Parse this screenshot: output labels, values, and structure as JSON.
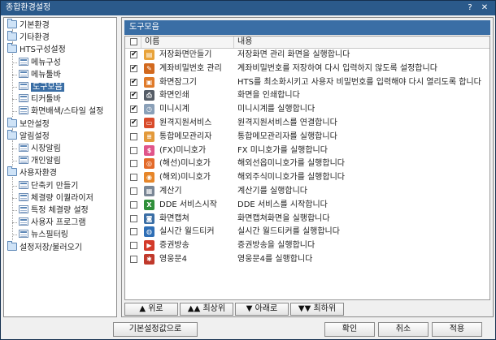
{
  "window": {
    "title": "종합환경설정",
    "help": "?",
    "close": "✕"
  },
  "tree": [
    {
      "label": "기본환경",
      "type": "folder",
      "level": 0
    },
    {
      "label": "기타환경",
      "type": "folder",
      "level": 0
    },
    {
      "label": "HTS구성설정",
      "type": "folder",
      "level": 0
    },
    {
      "label": "메뉴구성",
      "type": "page",
      "level": 1
    },
    {
      "label": "메뉴툴바",
      "type": "page",
      "level": 1
    },
    {
      "label": "도구모음",
      "type": "page",
      "level": 1,
      "selected": true
    },
    {
      "label": "티커툴바",
      "type": "page",
      "level": 1
    },
    {
      "label": "화면배색/스타일 설정",
      "type": "page",
      "level": 1
    },
    {
      "label": "보안설정",
      "type": "folder",
      "level": 0
    },
    {
      "label": "알림설정",
      "type": "folder",
      "level": 0
    },
    {
      "label": "시장알림",
      "type": "page",
      "level": 1
    },
    {
      "label": "개인알림",
      "type": "page",
      "level": 1
    },
    {
      "label": "사용자환경",
      "type": "folder",
      "level": 0
    },
    {
      "label": "단축키 만들기",
      "type": "page",
      "level": 1
    },
    {
      "label": "체결량 이퀄라이저",
      "type": "page",
      "level": 1
    },
    {
      "label": "특정 체결량 설정",
      "type": "page",
      "level": 1
    },
    {
      "label": "사용자 프로그램",
      "type": "page",
      "level": 1
    },
    {
      "label": "뉴스필터링",
      "type": "page",
      "level": 1
    },
    {
      "label": "설정저장/불러오기",
      "type": "folder",
      "level": 0
    }
  ],
  "panel": {
    "header": "도구모음",
    "columns": {
      "name": "이름",
      "desc": "내용"
    },
    "rows": [
      {
        "checked": true,
        "name": "저장화면만들기",
        "desc": "저장화면 관리 화면을 실행합니다",
        "icon": "save-screen-icon",
        "color": "#e8a33a",
        "glyph": "▤"
      },
      {
        "checked": true,
        "name": "계좌비밀번호 관리",
        "desc": "계좌비밀번호를 저장하여 다시 입력하지 않도록 설정합니다",
        "icon": "password-icon",
        "color": "#d2691e",
        "glyph": "✎"
      },
      {
        "checked": true,
        "name": "화면잠그기",
        "desc": "HTS를 최소화시키고 사용자 비밀번호를 입력해야 다시 열리도록 합니다",
        "icon": "lock-icon",
        "color": "#e07b2a",
        "glyph": "▣"
      },
      {
        "checked": true,
        "name": "화면인쇄",
        "desc": "화면을 인쇄합니다",
        "icon": "print-icon",
        "color": "#555c66",
        "glyph": "⎙"
      },
      {
        "checked": true,
        "name": "미니시계",
        "desc": "미니시계를 실행합니다",
        "icon": "clock-icon",
        "color": "#8aa0b8",
        "glyph": "◷"
      },
      {
        "checked": true,
        "name": "원격지원서비스",
        "desc": "원격지원서비스를 연결합니다",
        "icon": "remote-support-icon",
        "color": "#d94b2b",
        "glyph": "▭"
      },
      {
        "checked": false,
        "name": "통합메모관리자",
        "desc": "통합메모관리자를 실행합니다",
        "icon": "memo-icon",
        "color": "#e39a3b",
        "glyph": "≡"
      },
      {
        "checked": false,
        "name": "(FX)미니호가",
        "desc": "FX 미니호가를 실행합니다",
        "icon": "fx-icon",
        "color": "#e0558a",
        "glyph": "$"
      },
      {
        "checked": false,
        "name": "(해선)미니호가",
        "desc": "해외선옵미니호가를 실행합니다",
        "icon": "overseas-futures-icon",
        "color": "#e36a2a",
        "glyph": "◎"
      },
      {
        "checked": false,
        "name": "(해외)미니호가",
        "desc": "해외주식미니호가를 실행합니다",
        "icon": "overseas-stock-icon",
        "color": "#e6862a",
        "glyph": "◉"
      },
      {
        "checked": false,
        "name": "계산기",
        "desc": "계산기를 실행합니다",
        "icon": "calculator-icon",
        "color": "#7a8796",
        "glyph": "▦"
      },
      {
        "checked": false,
        "name": "DDE 서비스시작",
        "desc": "DDE 서비스를 시작합니다",
        "icon": "dde-icon",
        "color": "#2f8f3a",
        "glyph": "X"
      },
      {
        "checked": false,
        "name": "화면캡쳐",
        "desc": "화면캡쳐화면을 실행합니다",
        "icon": "capture-icon",
        "color": "#3a6ea5",
        "glyph": "◙"
      },
      {
        "checked": false,
        "name": "실시간 월드티커",
        "desc": "실시간 월드티커를 실행합니다",
        "icon": "world-ticker-icon",
        "color": "#2f6fb6",
        "glyph": "◍"
      },
      {
        "checked": false,
        "name": "증권방송",
        "desc": "증권방송을 실행합니다",
        "icon": "broadcast-icon",
        "color": "#d33a2a",
        "glyph": "▶"
      },
      {
        "checked": false,
        "name": "영웅문4",
        "desc": "영웅문4를 실행합니다",
        "icon": "hero-icon",
        "color": "#c0392b",
        "glyph": "✱"
      }
    ],
    "move_buttons": {
      "up": "▲ 위로",
      "top": "▲▲ 최상위",
      "down": "▼ 아래로",
      "bottom": "▼▼ 최하위"
    }
  },
  "footer": {
    "defaults": "기본설정값으로",
    "ok": "확인",
    "cancel": "취소",
    "apply": "적용"
  }
}
